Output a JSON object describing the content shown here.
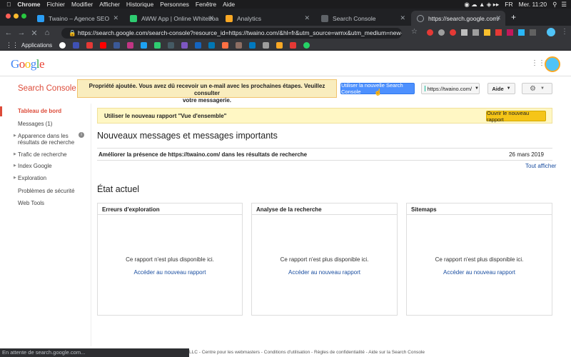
{
  "mac_menu": {
    "app": "Chrome",
    "items": [
      "Fichier",
      "Modifier",
      "Afficher",
      "Historique",
      "Personnes",
      "Fenêtre",
      "Aide"
    ],
    "clock": "Mer. 11:20",
    "flag": "FR"
  },
  "tabs": [
    {
      "label": "Twaino – Agence SEO",
      "color": "#2a9df4"
    },
    {
      "label": "AWW App | Online Whiteboard",
      "color": "#2ecc71"
    },
    {
      "label": "Analytics",
      "color": "#f9a825"
    },
    {
      "label": "Search Console",
      "color": "#5f6368"
    },
    {
      "label": "https://search.google.com/se",
      "color": "#9aa0a6"
    }
  ],
  "url": "https://search.google.com/search-console?resource_id=https://twaino.com/&hl=fr&utm_source=wmx&utm_medium=new-search...",
  "bookmarks": {
    "apps_label": "Applications"
  },
  "logo": "Google",
  "sc_title": "Search Console",
  "notice": {
    "line1": "Propriété ajoutée. Vous avez dû recevoir un e-mail avec les prochaines étapes. Veuillez consulter",
    "line2": "votre messagerie."
  },
  "buttons": {
    "new_sc": "Utiliser la nouvelle Search Console",
    "property": "https://twaino.com/",
    "help": "Aide"
  },
  "sidebar": [
    "Tableau de bord",
    "Messages (1)",
    "Apparence dans les résultats de recherche",
    "Trafic de recherche",
    "Index Google",
    "Exploration",
    "Problèmes de sécurité",
    "Web Tools"
  ],
  "promo": {
    "text": "Utiliser le nouveau rapport \"Vue d'ensemble\"",
    "button": "Ouvrir le nouveau rapport"
  },
  "messages": {
    "heading": "Nouveaux messages et messages importants",
    "item": "Améliorer la présence de https://twaino.com/ dans les résultats de recherche",
    "date": "26 mars 2019",
    "all": "Tout afficher"
  },
  "state": {
    "heading": "État actuel"
  },
  "cards": [
    {
      "title": "Erreurs d'exploration",
      "msg": "Ce rapport n'est plus disponible ici.",
      "link": "Accéder au nouveau rapport"
    },
    {
      "title": "Analyse de la recherche",
      "msg": "Ce rapport n'est plus disponible ici.",
      "link": "Accéder au nouveau rapport"
    },
    {
      "title": "Sitemaps",
      "msg": "Ce rapport n'est plus disponible ici.",
      "link": "Accéder au nouveau rapport"
    }
  ],
  "status": "En attente de search.google.com...",
  "footer": "LLC - Centre pour les webmasters - Conditions d'utilisation - Règles de confidentialité - Aide sur la Search Console"
}
